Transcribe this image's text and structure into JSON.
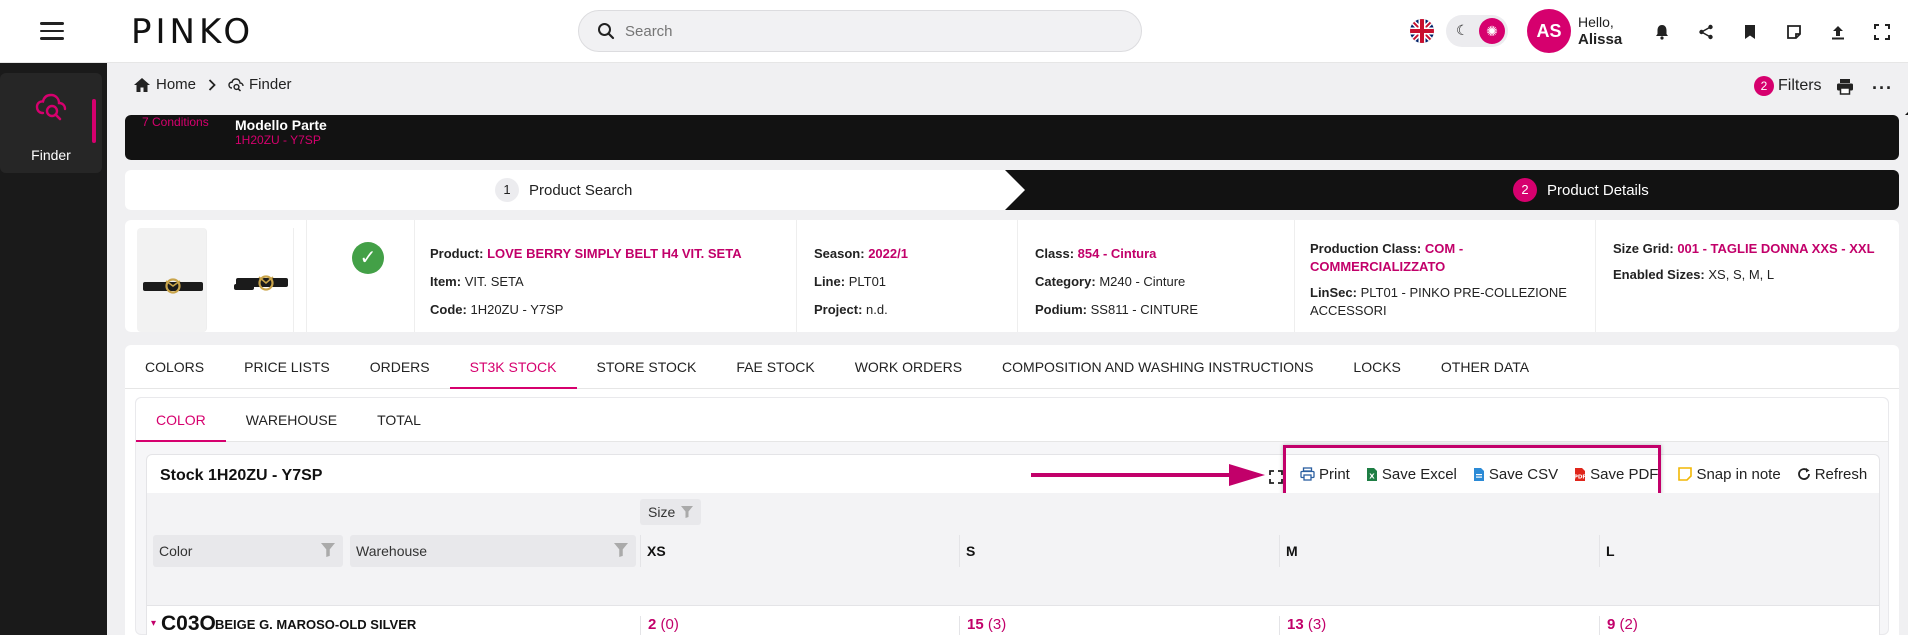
{
  "header": {
    "logo": "PINKO",
    "search_placeholder": "Search",
    "avatar_initials": "AS",
    "greeting": "Hello,",
    "user_name": "Alissa"
  },
  "sidebar": {
    "items": [
      {
        "label": "Finder"
      }
    ]
  },
  "breadcrumb": {
    "home": "Home",
    "current": "Finder"
  },
  "filters": {
    "count": "2",
    "label": "Filters"
  },
  "conditions": {
    "count_label": "7 Conditions",
    "title": "Modello Parte",
    "value": "1H20ZU - Y7SP"
  },
  "stepper": {
    "steps": [
      {
        "num": "1",
        "label": "Product Search"
      },
      {
        "num": "2",
        "label": "Product Details"
      }
    ]
  },
  "product": {
    "col1": [
      {
        "k": "Product:",
        "v": "LOVE BERRY SIMPLY BELT H4 VIT. SETA",
        "pink": true
      },
      {
        "k": "Item:",
        "v": "VIT. SETA"
      },
      {
        "k": "Code:",
        "v": "1H20ZU - Y7SP"
      }
    ],
    "col2": [
      {
        "k": "Season:",
        "v": "2022/1",
        "pink": true
      },
      {
        "k": "Line:",
        "v": "PLT01"
      },
      {
        "k": "Project:",
        "v": "n.d."
      }
    ],
    "col3": [
      {
        "k": "Class:",
        "v": "854 - Cintura",
        "pink": true
      },
      {
        "k": "Category:",
        "v": "M240 - Cinture"
      },
      {
        "k": "Podium:",
        "v": "SS811 - CINTURE"
      }
    ],
    "col4": [
      {
        "k": "Production Class:",
        "v": "COM - COMMERCIALIZZATO",
        "pink": true
      },
      {
        "k": "LinSec:",
        "v": "PLT01 - PINKO PRE-COLLEZIONE ACCESSORI"
      }
    ],
    "col5": [
      {
        "k": "Size Grid:",
        "v": "001 - TAGLIE DONNA XXS - XXL",
        "pink": true
      },
      {
        "k": "Enabled Sizes:",
        "v": "XS, S, M, L"
      }
    ]
  },
  "main_tabs": [
    "COLORS",
    "PRICE LISTS",
    "ORDERS",
    "ST3K STOCK",
    "STORE STOCK",
    "FAE STOCK",
    "WORK ORDERS",
    "COMPOSITION AND WASHING INSTRUCTIONS",
    "LOCKS",
    "OTHER DATA"
  ],
  "main_tab_active": "ST3K STOCK",
  "sub_tabs": [
    "COLOR",
    "WAREHOUSE",
    "TOTAL"
  ],
  "sub_tab_active": "COLOR",
  "grid": {
    "title": "Stock 1H20ZU - Y7SP",
    "toolbar": {
      "print": "Print",
      "save_excel": "Save Excel",
      "save_csv": "Save CSV",
      "save_pdf": "Save PDF",
      "snap": "Snap in note",
      "refresh": "Refresh"
    },
    "size_chip": "Size",
    "filter_color": "Color",
    "filter_warehouse": "Warehouse",
    "sizes": [
      "XS",
      "S",
      "M",
      "L"
    ],
    "rows": [
      {
        "code": "C03O",
        "name": "BEIGE G. MAROSO-OLD SILVER",
        "cells": [
          {
            "v": "2",
            "p": "(0)"
          },
          {
            "v": "15",
            "p": "(3)"
          },
          {
            "v": "13",
            "p": "(3)"
          },
          {
            "v": "9",
            "p": "(2)"
          }
        ]
      }
    ]
  },
  "colors": {
    "accent": "#d6006e",
    "dark": "#121212"
  }
}
